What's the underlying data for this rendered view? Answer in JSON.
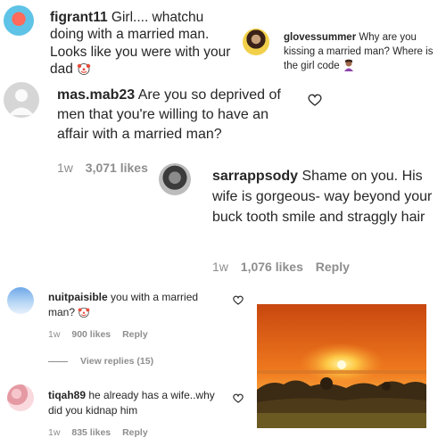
{
  "comments": [
    {
      "username": "figrant11",
      "text": "Girl.... whatchu doing with a married man. Looks like you were with your dad",
      "emoji": "clown-face"
    },
    {
      "username": "glovessummer",
      "text": "Why are you kissing a married man? Where is the girl code",
      "emoji": "woman-facepalming"
    },
    {
      "username": "mas.mab23",
      "text": "Are you so deprived of men that you're willing to have an affair with a married man?",
      "time": "1w",
      "likes": "3,071 likes"
    },
    {
      "username": "sarrappsody",
      "text": "Shame on you. His wife is gorgeous- way beyond your buck tooth smile and straggly hair",
      "time": "1w",
      "likes": "1,076 likes",
      "reply": "Reply"
    },
    {
      "username": "nuitpaisible",
      "text": "you with a married man?",
      "emoji": "clown-face",
      "time": "1w",
      "likes": "900 likes",
      "reply": "Reply",
      "view_replies": "View replies (15)"
    },
    {
      "username": "tiqah89",
      "text": "he already has a wife..why did you kidnap him",
      "time": "1w",
      "likes": "835 likes",
      "reply": "Reply"
    }
  ],
  "colors": {
    "text": "#262626",
    "meta": "#8e8e8e",
    "sunset_orange": "#f07a1e"
  }
}
